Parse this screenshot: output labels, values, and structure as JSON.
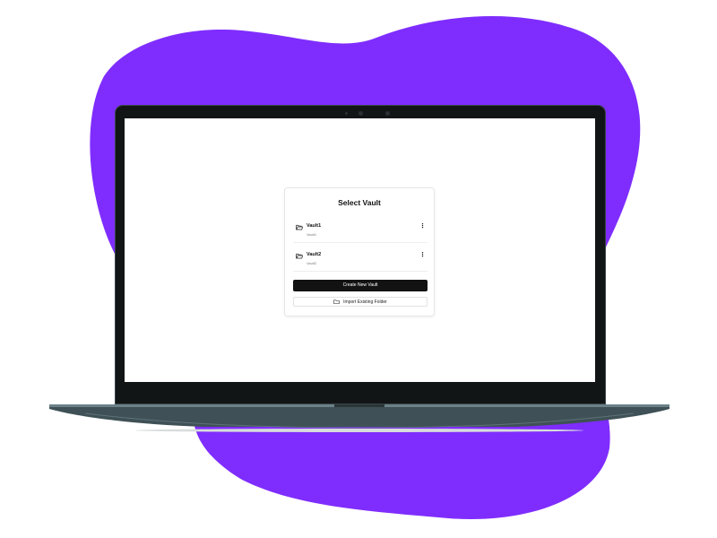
{
  "theme": {
    "accent": "#7f2dfe",
    "primary_button": "#121212"
  },
  "dialog": {
    "title": "Select Vault",
    "vaults": [
      {
        "name": "Vault1",
        "path": "Vault1",
        "icon": "folder-open-icon",
        "menu_icon": "more-vertical-icon"
      },
      {
        "name": "Vault2",
        "path": "Vault2",
        "icon": "folder-open-icon",
        "menu_icon": "more-vertical-icon"
      }
    ],
    "create_label": "Create New Vault",
    "import_label": "Import Existing Folder",
    "import_icon": "folder-import-icon",
    "menu_glyph": "⋮"
  }
}
